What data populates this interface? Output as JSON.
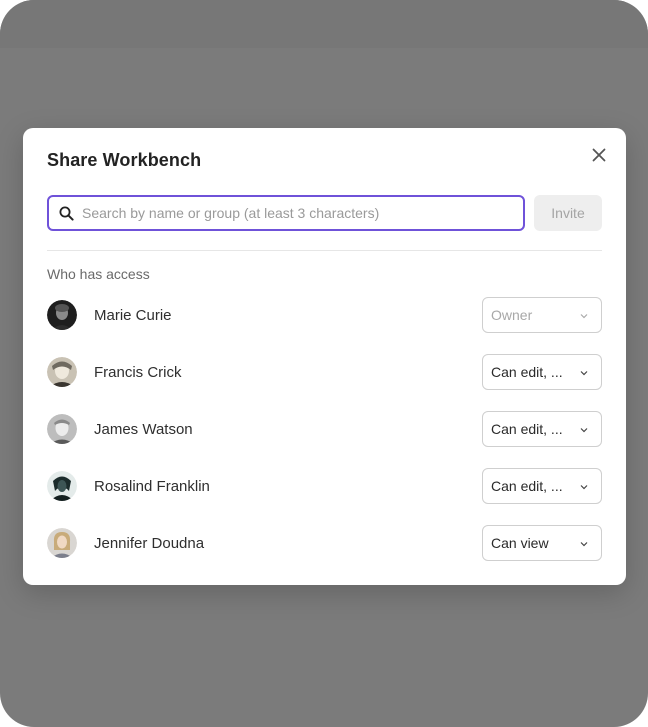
{
  "modal": {
    "title": "Share Workbench",
    "search": {
      "placeholder": "Search by name or group (at least 3 characters)",
      "value": ""
    },
    "invite_label": "Invite",
    "section_label": "Who has access",
    "people": [
      {
        "name": "Marie Curie",
        "role": "Owner",
        "disabled": true
      },
      {
        "name": "Francis Crick",
        "role": "Can edit, ...",
        "disabled": false
      },
      {
        "name": "James Watson",
        "role": "Can edit, ...",
        "disabled": false
      },
      {
        "name": "Rosalind Franklin",
        "role": "Can edit, ...",
        "disabled": false
      },
      {
        "name": "Jennifer Doudna",
        "role": "Can view",
        "disabled": false
      }
    ]
  },
  "colors": {
    "accent": "#6f52d9",
    "backdrop": "#7b7b7b",
    "invite_bg": "#eeeeee"
  },
  "icons": {
    "close": "close-icon",
    "search": "search-icon",
    "dropdown": "chevron-down-icon"
  }
}
